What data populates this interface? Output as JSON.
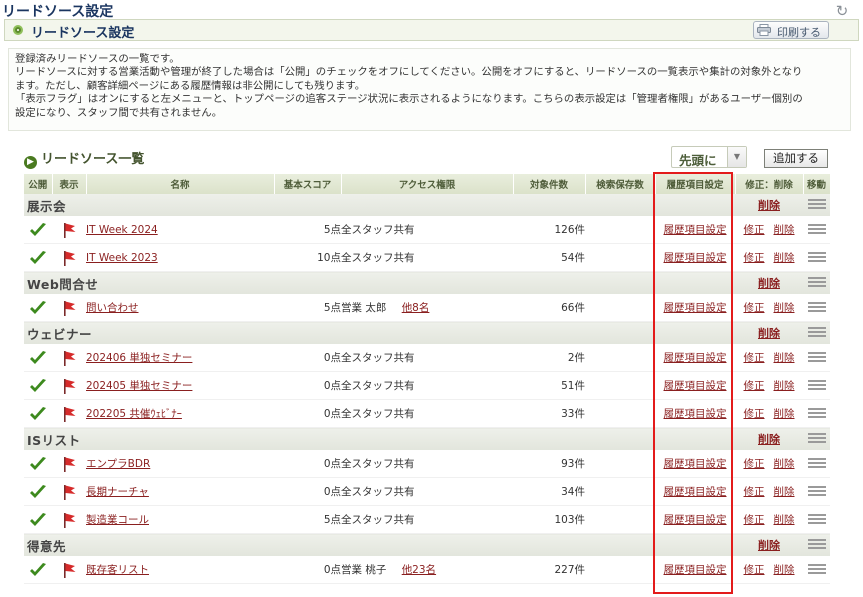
{
  "page": {
    "title": "リードソース設定"
  },
  "header": {
    "title": "リードソース設定",
    "print_label": "印刷する"
  },
  "description": {
    "lines": [
      "登録済みリードソースの一覧です。",
      "リードソースに対する営業活動や管理が終了した場合は「公開」のチェックをオフにしてください。公開をオフにすると、リードソースの一覧表示や集計の対象外となり",
      "ます。ただし、顧客詳細ページにある履歴情報は非公開にしても残ります。",
      "「表示フラグ」はオンにすると左メニューと、トップページの追客ステージ状況に表示されるようになります。こちらの表示設定は「管理者権限」があるユーザー個別の",
      "設定になり、スタッフ間で共有されません。"
    ]
  },
  "list": {
    "title": "リードソース一覧",
    "sort_value": "先頭に",
    "add_label": "追加する",
    "headers": {
      "public": "公開",
      "display": "表示",
      "name": "名称",
      "score": "基本スコア",
      "access": "アクセス権限",
      "count": "対象件数",
      "saved": "検索保存数",
      "history": "履歴項目設定",
      "edit_delete": "修正：削除",
      "move": "移動"
    },
    "history_link": "履歴項目設定",
    "edit_label": "修正",
    "delete_label": "削除",
    "categories": [
      {
        "name": "展示会",
        "items": [
          {
            "name": "IT Week 2024",
            "score": "5点",
            "access": "全スタッフ共有",
            "access_more": "",
            "count": "126件"
          },
          {
            "name": "IT Week 2023",
            "score": "10点",
            "access": "全スタッフ共有",
            "access_more": "",
            "count": "54件"
          }
        ]
      },
      {
        "name": "Web問合せ",
        "items": [
          {
            "name": "問い合わせ",
            "score": "5点",
            "access": "営業 太郎",
            "access_more": "他8名",
            "count": "66件"
          }
        ]
      },
      {
        "name": "ウェビナー",
        "items": [
          {
            "name": "202406 単独セミナー",
            "score": "0点",
            "access": "全スタッフ共有",
            "access_more": "",
            "count": "2件"
          },
          {
            "name": "202405 単独セミナー",
            "score": "0点",
            "access": "全スタッフ共有",
            "access_more": "",
            "count": "51件"
          },
          {
            "name": "202205 共催ｳｪﾋﾞﾅｰ",
            "score": "0点",
            "access": "全スタッフ共有",
            "access_more": "",
            "count": "33件"
          }
        ]
      },
      {
        "name": "ISリスト",
        "items": [
          {
            "name": "エンプラBDR",
            "score": "0点",
            "access": "全スタッフ共有",
            "access_more": "",
            "count": "93件"
          },
          {
            "name": "長期ナーチャ",
            "score": "0点",
            "access": "全スタッフ共有",
            "access_more": "",
            "count": "34件"
          },
          {
            "name": "製造業コール",
            "score": "5点",
            "access": "全スタッフ共有",
            "access_more": "",
            "count": "103件"
          }
        ]
      },
      {
        "name": "得意先",
        "items": [
          {
            "name": "既存客リスト",
            "score": "0点",
            "access": "営業 桃子",
            "access_more": "他23名",
            "count": "227件"
          }
        ]
      }
    ]
  },
  "colors": {
    "highlight": "#e31b1b",
    "link": "#8a1f1f",
    "check": "#3d8a1e",
    "flag": "#d62b2b"
  }
}
